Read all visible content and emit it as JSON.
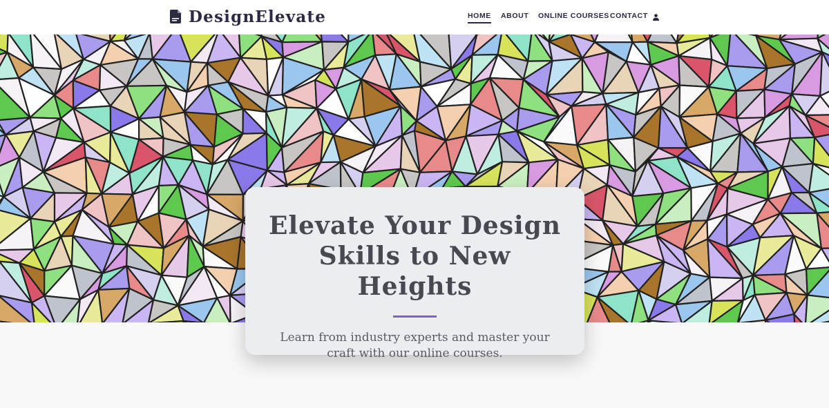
{
  "brand": {
    "name": "DesignElevate",
    "logo_icon": "document-icon"
  },
  "nav": {
    "items": [
      {
        "label": "HOME",
        "active": true
      },
      {
        "label": "ABOUT",
        "active": false
      },
      {
        "label": "ONLINE COURSES",
        "active": false
      },
      {
        "label": "CONTACT",
        "active": false
      }
    ],
    "user_icon": "user-icon"
  },
  "hero": {
    "image": "stained-glass mosaic pattern",
    "title": "Elevate Your Design Skills to New Heights",
    "subtitle": "Learn from industry experts and master your craft with our online courses.",
    "accent_color": "#7b61c9"
  },
  "colors": {
    "brand_text": "#2c2a45",
    "card_bg": "#ecedf0",
    "page_bg": "#f8f8f8"
  }
}
